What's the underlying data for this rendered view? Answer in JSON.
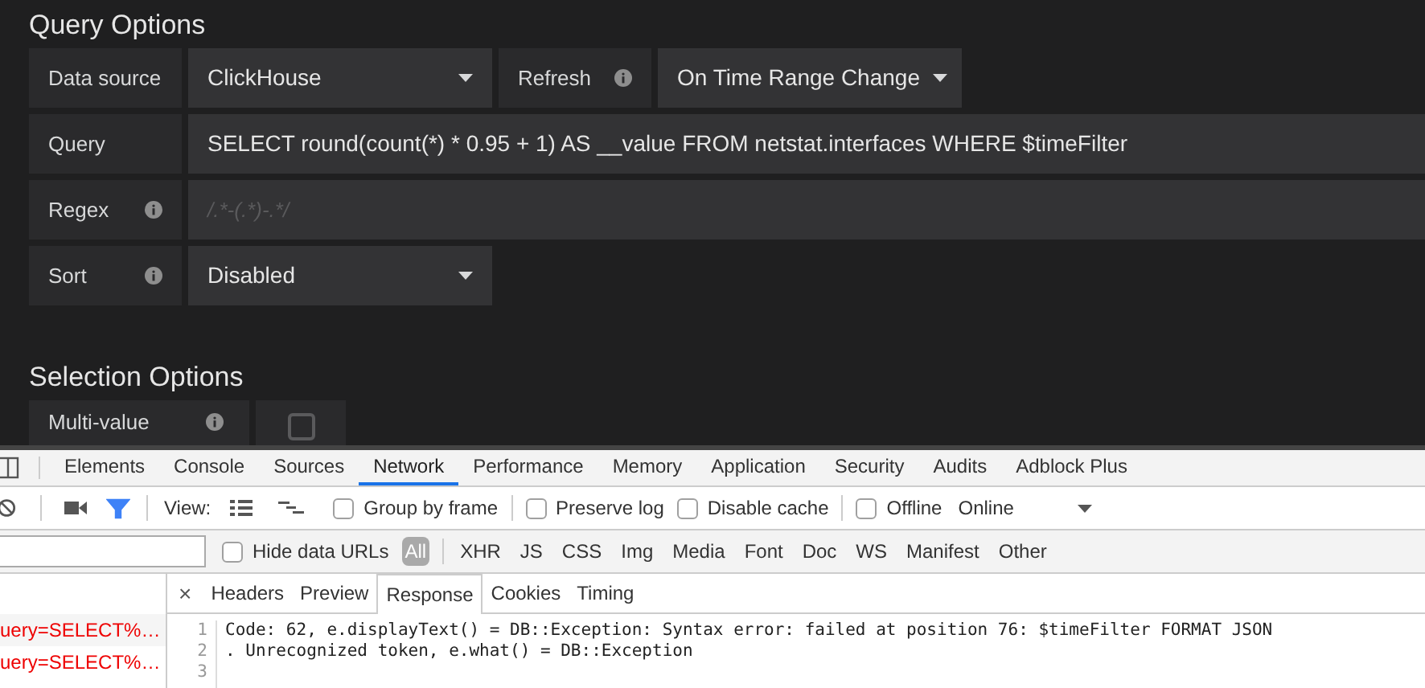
{
  "query_options": {
    "title": "Query Options",
    "rows": [
      [
        {
          "kind": "label",
          "text": "Data source",
          "info": false
        },
        {
          "kind": "select",
          "value": "ClickHouse"
        },
        {
          "kind": "label",
          "text": "Refresh",
          "info": true
        },
        {
          "kind": "select",
          "value": "On Time Range Change"
        }
      ],
      [
        {
          "kind": "label",
          "text": "Query",
          "info": false
        },
        {
          "kind": "input",
          "value": "SELECT round(count(*) * 0.95 + 1) AS __value FROM netstat.interfaces WHERE $timeFilter"
        }
      ],
      [
        {
          "kind": "label",
          "text": "Regex",
          "info": true
        },
        {
          "kind": "input",
          "placeholder": "/.*-(.*)-.*/"
        }
      ],
      [
        {
          "kind": "label",
          "text": "Sort",
          "info": true
        },
        {
          "kind": "select",
          "value": "Disabled"
        }
      ]
    ]
  },
  "selection_options": {
    "title": "Selection Options",
    "multi_value": {
      "label": "Multi-value",
      "checked": false
    }
  },
  "devtools": {
    "tabs": [
      {
        "label": "Elements",
        "selected": false
      },
      {
        "label": "Console",
        "selected": false
      },
      {
        "label": "Sources",
        "selected": false
      },
      {
        "label": "Network",
        "selected": true
      },
      {
        "label": "Performance",
        "selected": false
      },
      {
        "label": "Memory",
        "selected": false
      },
      {
        "label": "Application",
        "selected": false
      },
      {
        "label": "Security",
        "selected": false
      },
      {
        "label": "Audits",
        "selected": false
      },
      {
        "label": "Adblock Plus",
        "selected": false
      }
    ],
    "toolbar": {
      "filter_active": true,
      "view_label": "View:",
      "checkboxes": [
        {
          "label": "Group by frame",
          "checked": false
        },
        {
          "label": "Preserve log",
          "checked": false
        },
        {
          "label": "Disable cache",
          "checked": false
        },
        {
          "label": "Offline",
          "checked": false
        }
      ],
      "throttle": "Online"
    },
    "filter_bar": {
      "hide_data_urls": {
        "label": "Hide data URLs",
        "checked": false
      },
      "types": [
        {
          "label": "All",
          "selected": true
        },
        {
          "label": "XHR",
          "selected": false
        },
        {
          "label": "JS",
          "selected": false
        },
        {
          "label": "CSS",
          "selected": false
        },
        {
          "label": "Img",
          "selected": false
        },
        {
          "label": "Media",
          "selected": false
        },
        {
          "label": "Font",
          "selected": false
        },
        {
          "label": "Doc",
          "selected": false
        },
        {
          "label": "WS",
          "selected": false
        },
        {
          "label": "Manifest",
          "selected": false
        },
        {
          "label": "Other",
          "selected": false
        }
      ]
    },
    "requests": [
      {
        "name": "uery=SELECT%…",
        "failed": true
      },
      {
        "name": "uery=SELECT%…",
        "failed": true
      }
    ],
    "detail_tabs": {
      "close": "×",
      "tabs": [
        {
          "label": "Headers",
          "selected": false
        },
        {
          "label": "Preview",
          "selected": false
        },
        {
          "label": "Response",
          "selected": true
        },
        {
          "label": "Cookies",
          "selected": false
        },
        {
          "label": "Timing",
          "selected": false
        }
      ]
    },
    "response_lines": [
      {
        "number": "1",
        "text": "Code: 62, e.displayText() = DB::Exception: Syntax error: failed at position 76: $timeFilter FORMAT JSON"
      },
      {
        "number": "2",
        "text": ". Unrecognized token, e.what() = DB::Exception"
      },
      {
        "number": "3"
      }
    ]
  }
}
